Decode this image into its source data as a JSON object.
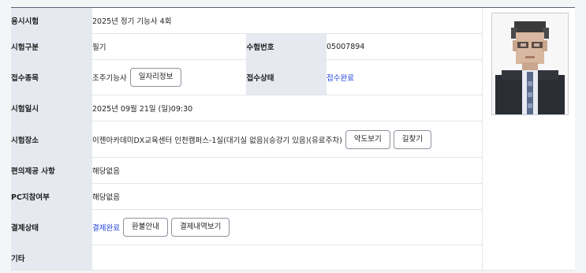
{
  "rows": {
    "exam": {
      "label": "응시시험",
      "value": "2025년 정기 기능사 4회"
    },
    "category": {
      "label": "시험구분",
      "value": "필기",
      "label2": "수험번호",
      "value2": "05007894"
    },
    "job": {
      "label": "접수종목",
      "value": "조주기능사",
      "button": "일자리정보",
      "label2": "접수상태",
      "value2": "접수완료"
    },
    "date": {
      "label": "시험일시",
      "value": "2025년 09월 21일 (일)09:30"
    },
    "venue": {
      "label": "시험장소",
      "value": "이젠아카데미DX교육센터 인천캠퍼스-1실(대기실 없음)(승강기 있음)(유료주차)",
      "button_map": "약도보기",
      "button_route": "길찾기"
    },
    "convenience": {
      "label": "편의제공 사항",
      "value": "해당없음"
    },
    "pc": {
      "label": "PC지참여부",
      "value": "해당없음"
    },
    "payment": {
      "label": "결제상태",
      "value": "결제완료",
      "button_refund": "환불안내",
      "button_history": "결제내역보기"
    },
    "etc": {
      "label": "기타",
      "value": ""
    }
  },
  "colors": {
    "header_bg": "#e6e9f0",
    "status_blue": "#1f3fd9",
    "top_border": "#5b6472"
  },
  "photo": {
    "icon": "applicant-photo"
  }
}
